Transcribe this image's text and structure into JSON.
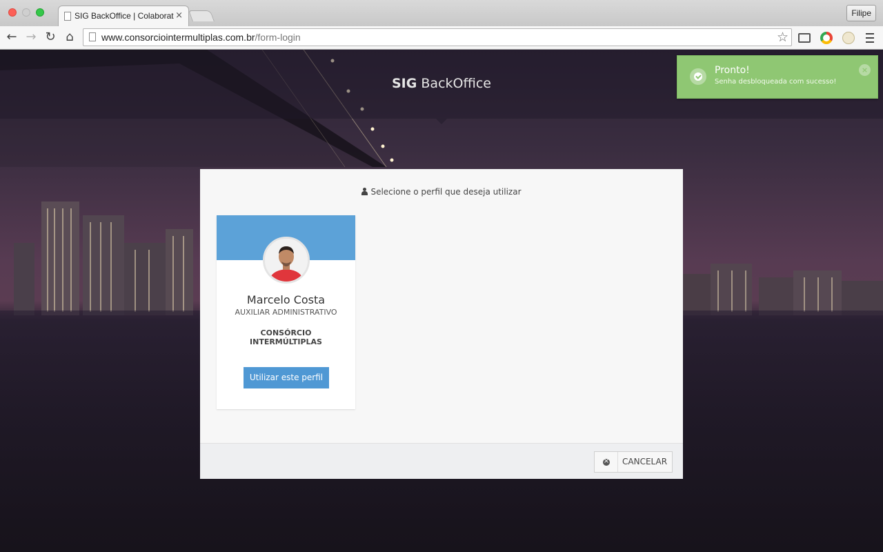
{
  "browser": {
    "tab_title": "SIG BackOffice | Colaborat",
    "tab_close": "×",
    "user_button": "Filipe",
    "url_host": "www.consorciointermultiplas.com.br",
    "url_path": "/form-login"
  },
  "header": {
    "brand_bold": "SIG",
    "brand_rest": " BackOffice"
  },
  "toast": {
    "title": "Pronto!",
    "message": "Senha desbloqueada com sucesso!",
    "close": "×",
    "color": "#8fc773"
  },
  "modal": {
    "heading": "Selecione o perfil que deseja utilizar",
    "profile": {
      "name": "Marcelo Costa",
      "role": "AUXILIAR ADMINISTRATIVO",
      "company": "CONSÓRCIO INTERMÚLTIPLAS",
      "button": "Utilizar este perfil",
      "banner_color": "#5ca2d8"
    },
    "cancel_button": "CANCELAR"
  }
}
